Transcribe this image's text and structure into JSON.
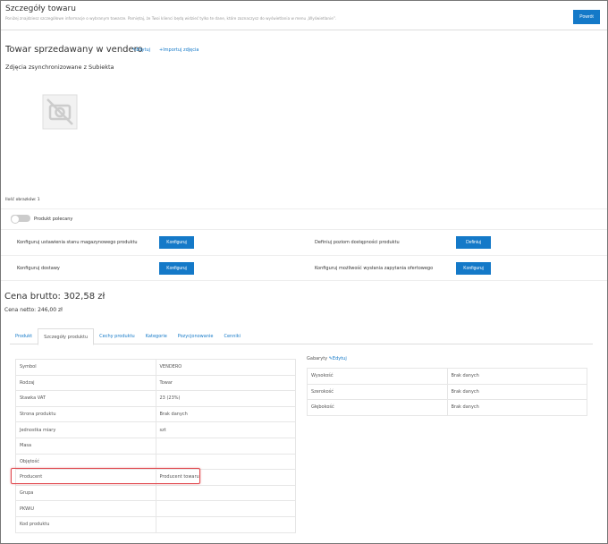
{
  "header": {
    "title": "Szczegóły towaru",
    "subtitle": "Poniżej znajdziesz szczegółowe informacje o wybranym towarze. Pamiętaj, że Twoi klienci będą widzieć tylko te dane, które zaznaczysz do wyświetlania w menu „Wyświetlanie”.",
    "back_label": "Powrót"
  },
  "product": {
    "title": "Towar sprzedawany w vendero",
    "edit_label": "Edytuj",
    "import_label": "Importuj zdjęcia",
    "photos_heading": "Zdjęcia zsynchronizowane z Subiekta",
    "image_count": "Ilość obrazków: 1",
    "featured_label": "Produkt polecany",
    "featured_on": false
  },
  "config": [
    {
      "label": "Konfiguruj ustawienia stanu magazynowego produktu",
      "button": "Konfiguruj"
    },
    {
      "label": "Definiuj poziom dostępności produktu",
      "button": "Definiuj"
    },
    {
      "label": "Konfiguruj dostawy",
      "button": "Konfiguruj"
    },
    {
      "label": "Konfiguruj możliwość wysłania zapytania ofertowego",
      "button": "Konfiguruj"
    }
  ],
  "price": {
    "gross": "Cena brutto: 302,58 zł",
    "net": "Cena netto: 246,00 zł"
  },
  "tabs": [
    "Produkt",
    "Szczegóły produktu",
    "Cechy produktu",
    "Kategorie",
    "Pozycjonowanie",
    "Cenniki"
  ],
  "active_tab": "Szczegóły produktu",
  "details": [
    [
      "Symbol",
      "VENDERO"
    ],
    [
      "Rodzaj",
      "Towar"
    ],
    [
      "Stawka VAT",
      "23 (23%)"
    ],
    [
      "Strona produktu",
      "Brak danych"
    ],
    [
      "Jednostka miary",
      "szt"
    ],
    [
      "Masa",
      ""
    ],
    [
      "Objętość",
      ""
    ],
    [
      "Producent",
      "Producent towaru"
    ],
    [
      "Grupa",
      ""
    ],
    [
      "PKWiU",
      ""
    ],
    [
      "Kod produktu",
      ""
    ]
  ],
  "dimensions": {
    "heading": "Gabaryty",
    "edit_label": "Edytuj",
    "rows": [
      [
        "Wysokość",
        "Brak danych"
      ],
      [
        "Szerokość",
        "Brak danych"
      ],
      [
        "Głębokość",
        "Brak danych"
      ]
    ]
  },
  "colors": {
    "accent": "#1479c8",
    "highlight": "#e0484e"
  }
}
